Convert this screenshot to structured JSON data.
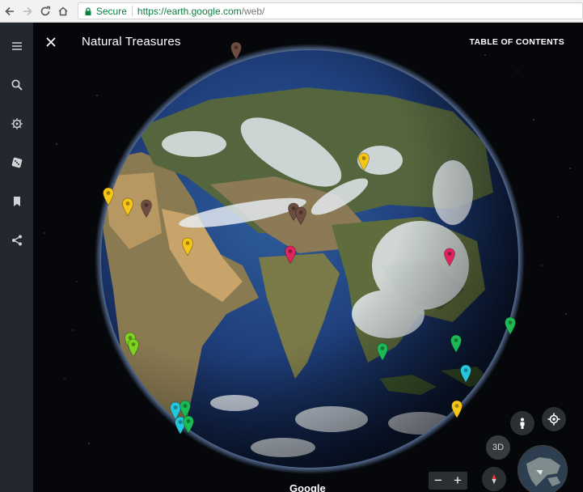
{
  "browser": {
    "secure_label": "Secure",
    "url_host": "https://earth.google.com",
    "url_path": "/web/"
  },
  "sidebar": {
    "items": [
      {
        "icon": "menu-icon"
      },
      {
        "icon": "search-icon"
      },
      {
        "icon": "voyager-icon"
      },
      {
        "icon": "dice-icon"
      },
      {
        "icon": "bookmark-icon"
      },
      {
        "icon": "share-icon"
      }
    ]
  },
  "panel": {
    "title": "Natural Treasures",
    "toc_label": "TABLE OF CONTENTS"
  },
  "controls": {
    "label_3d": "3D",
    "zoom_out": "−",
    "zoom_in": "+"
  },
  "attribution": "Google",
  "colors": {
    "sidebar_bg": "#22282d",
    "pin_yellow": "#f5c518",
    "pin_brown": "#6d4c41",
    "pin_red": "#e0245e",
    "pin_green": "#1db954",
    "pin_cyan": "#26c6da",
    "pin_lightgreen": "#7ed321"
  },
  "pins": [
    {
      "color": "brown"
    },
    {
      "color": "yellow"
    },
    {
      "color": "yellow"
    },
    {
      "color": "yellow"
    },
    {
      "color": "brown"
    },
    {
      "color": "brown"
    },
    {
      "color": "brown"
    },
    {
      "color": "yellow"
    },
    {
      "color": "red"
    },
    {
      "color": "red"
    },
    {
      "color": "lightgreen"
    },
    {
      "color": "lightgreen"
    },
    {
      "color": "green"
    },
    {
      "color": "green"
    },
    {
      "color": "green"
    },
    {
      "color": "cyan"
    },
    {
      "color": "yellow"
    },
    {
      "color": "cyan"
    },
    {
      "color": "green"
    },
    {
      "color": "cyan"
    },
    {
      "color": "green"
    }
  ]
}
